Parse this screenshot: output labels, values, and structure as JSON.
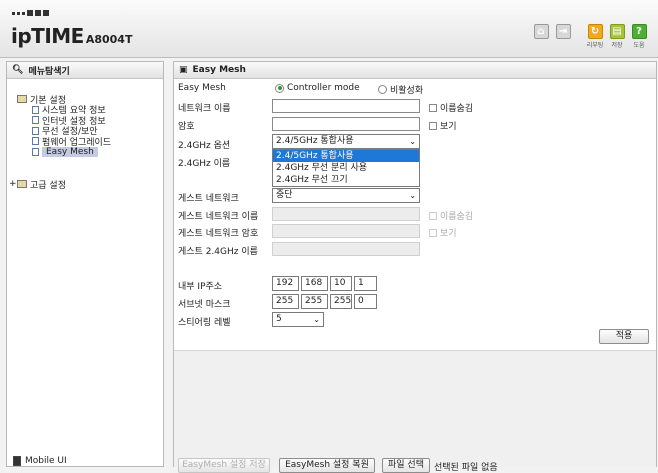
{
  "header": {
    "brand": "ipTIME",
    "model": "A8004T",
    "icons": [
      {
        "name": "home-icon",
        "caption": ""
      },
      {
        "name": "logout-icon",
        "caption": ""
      },
      {
        "name": "restart-icon",
        "caption": "리부팅"
      },
      {
        "name": "save-icon",
        "caption": "저장"
      },
      {
        "name": "help-icon",
        "caption": "도움"
      }
    ]
  },
  "left": {
    "title": "메뉴탐색기",
    "basic": "기본 설정",
    "items": [
      "시스템 요약 정보",
      "인터넷 설정 정보",
      "무선 설정/보안",
      "펌웨어 업그레이드",
      "Easy Mesh"
    ],
    "advanced": "고급 설정",
    "mobile": "Mobile UI"
  },
  "main": {
    "title": "Easy Mesh",
    "easymesh_label": "Easy Mesh",
    "mode_controller": "Controller mode",
    "mode_disabled": "비활성화",
    "network_name": "네트워크 이름",
    "hide_name": "이름숨김",
    "password": "암호",
    "show": "보기",
    "band_option": "2.4GHz 옵션",
    "band_selected": "2.4/5GHz 통합사용",
    "band_options": [
      "2.4/5GHz 통합사용",
      "2.4GHz 무선 분리 사용",
      "2.4GHz 무선 끄기"
    ],
    "band_name": "2.4GHz 이름",
    "guest_network": "게스트 네트워크",
    "guest_selected": "중단",
    "guest_name": "게스트 네트워크 이름",
    "guest_hide": "이름숨김",
    "guest_password": "게스트 네트워크 암호",
    "guest_show": "보기",
    "guest_24_name": "게스트 2.4GHz 이름",
    "internal_ip": "내부 IP주소",
    "ip": [
      "192",
      "168",
      "10",
      "1"
    ],
    "subnet": "서브넷 마스크",
    "mask": [
      "255",
      "255",
      "255",
      "0"
    ],
    "steering": "스티어링 레벨",
    "steering_value": "5",
    "apply": "적용",
    "btn_save_disabled": "EasyMesh 설정 저장",
    "btn_restore": "EasyMesh 설정 복원",
    "btn_file": "파일 선택",
    "file_status": "선택된 파일 없음"
  }
}
